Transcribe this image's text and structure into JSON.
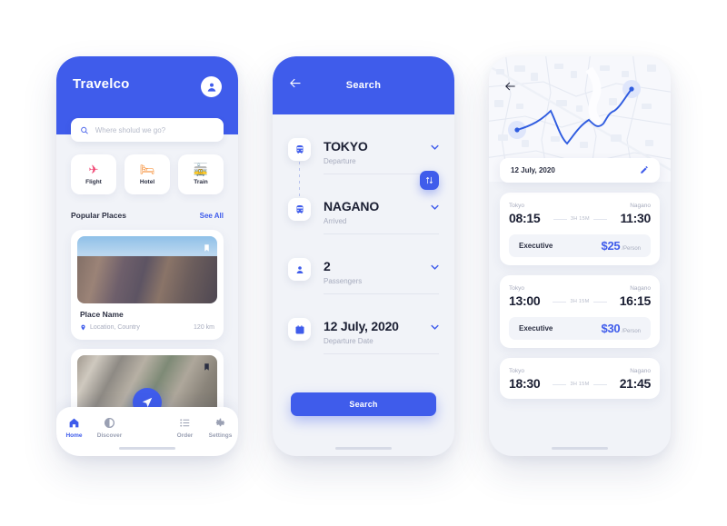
{
  "home": {
    "brand": "Travelco",
    "avatar_icon": "user-circle-icon",
    "search": {
      "icon": "search-icon",
      "placeholder": "Where sholud we go?",
      "value": ""
    },
    "categories": [
      {
        "label": "Flight",
        "glyph": "✈",
        "color": "#ef3e6d",
        "icon": "airplane-icon"
      },
      {
        "label": "Hotel",
        "glyph": "🛏",
        "color": "#f6821f",
        "icon": "bed-icon"
      },
      {
        "label": "Train",
        "glyph": "🚃",
        "color": "#17b23c",
        "icon": "train-icon"
      }
    ],
    "section": {
      "title": "Popular Places",
      "link": "See All"
    },
    "places": [
      {
        "name": "Place Name",
        "location": "Location, Country",
        "distance": "120 km",
        "bookmark_icon": "bookmark-icon"
      },
      {
        "name": "",
        "location": "",
        "distance": "",
        "bookmark_icon": "bookmark-icon"
      }
    ],
    "fab_icon": "navigation-arrow-icon",
    "tabs": [
      {
        "label": "Home",
        "icon": "home-icon",
        "active": true
      },
      {
        "label": "Discover",
        "icon": "compass-icon",
        "active": false
      },
      {
        "label": "Order",
        "icon": "list-icon",
        "active": false
      },
      {
        "label": "Settings",
        "icon": "gear-icon",
        "active": false
      }
    ]
  },
  "search": {
    "back_icon": "back-arrow-icon",
    "title": "Search",
    "swap_icon": "swap-vertical-icon",
    "fields": [
      {
        "value": "TOKYO",
        "sub": "Departure",
        "icon": "train-icon",
        "chevron": "chevron-down-icon"
      },
      {
        "value": "NAGANO",
        "sub": "Arrived",
        "icon": "train-icon",
        "chevron": "chevron-down-icon"
      },
      {
        "value": "2",
        "sub": "Passengers",
        "icon": "person-icon",
        "chevron": "chevron-down-icon"
      },
      {
        "value": "12 July, 2020",
        "sub": "Departure Date",
        "icon": "calendar-icon",
        "chevron": "chevron-down-icon"
      }
    ],
    "submit_label": "Search"
  },
  "results": {
    "back_icon": "back-arrow-icon",
    "map": {
      "route_color": "#2f5ce0",
      "start_marker": "route-start-marker",
      "end_marker": "route-end-marker"
    },
    "date_bar": {
      "date": "12 July, 2020",
      "edit_icon": "pencil-icon"
    },
    "trips": [
      {
        "from_city": "Tokyo",
        "to_city": "Nagano",
        "depart": "08:15",
        "arrive": "11:30",
        "duration": "3H 15M",
        "class": "Executive",
        "price": "$25",
        "price_unit": "/Person"
      },
      {
        "from_city": "Tokyo",
        "to_city": "Nagano",
        "depart": "13:00",
        "arrive": "16:15",
        "duration": "3H 15M",
        "class": "Executive",
        "price": "$30",
        "price_unit": "/Person"
      },
      {
        "from_city": "Tokyo",
        "to_city": "Nagano",
        "depart": "18:30",
        "arrive": "21:45",
        "duration": "3H 15M",
        "class": "",
        "price": "",
        "price_unit": ""
      }
    ]
  },
  "theme": {
    "primary": "#3f5ceb",
    "background": "#ffffff",
    "surface": "#f1f3f8",
    "text": "#1b1f33",
    "muted": "#a6abbd"
  }
}
